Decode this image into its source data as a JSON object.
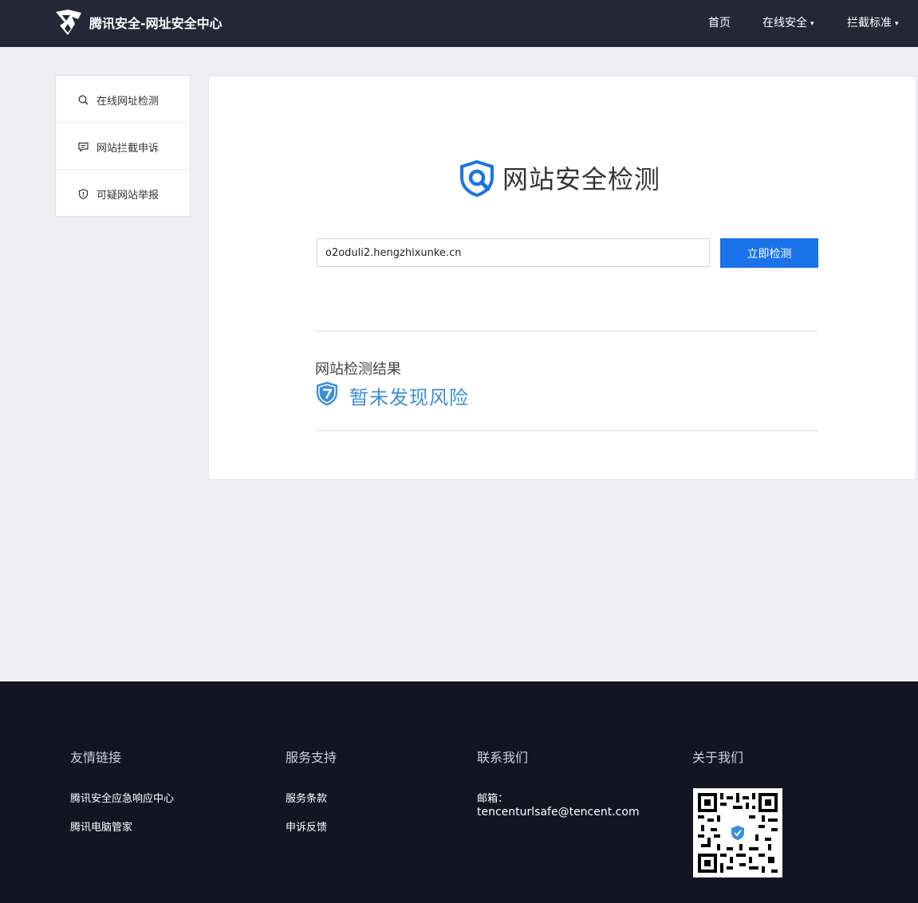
{
  "header": {
    "brand": "腾讯安全-网址安全中心",
    "nav": [
      {
        "label": "首页",
        "has_caret": false
      },
      {
        "label": "在线安全",
        "has_caret": true
      },
      {
        "label": "拦截标准",
        "has_caret": true
      }
    ],
    "caret": "▾"
  },
  "sidebar": {
    "items": [
      {
        "label": "在线网址检测",
        "icon": "search-icon"
      },
      {
        "label": "网站拦截申诉",
        "icon": "chat-icon"
      },
      {
        "label": "可疑网站举报",
        "icon": "shield-alert-icon"
      }
    ]
  },
  "main": {
    "title": "网站安全检测",
    "url_value": "o2oduli2.hengzhixunke.cn",
    "check_button": "立即检测",
    "result_label": "网站检测结果",
    "result_text": "暂未发现风险"
  },
  "footer": {
    "columns": [
      {
        "heading": "友情链接",
        "links": [
          "腾讯安全应急响应中心",
          "腾讯电脑管家"
        ]
      },
      {
        "heading": "服务支持",
        "links": [
          "服务条款",
          "申诉反馈"
        ]
      },
      {
        "heading": "联系我们",
        "email_label": "邮箱：",
        "email": "tencenturlsafe@tencent.com"
      },
      {
        "heading": "关于我们"
      }
    ]
  },
  "colors": {
    "topbar": "#242836",
    "accent": "#1a73e8",
    "result": "#3b8ed8",
    "footer": "#131523"
  }
}
